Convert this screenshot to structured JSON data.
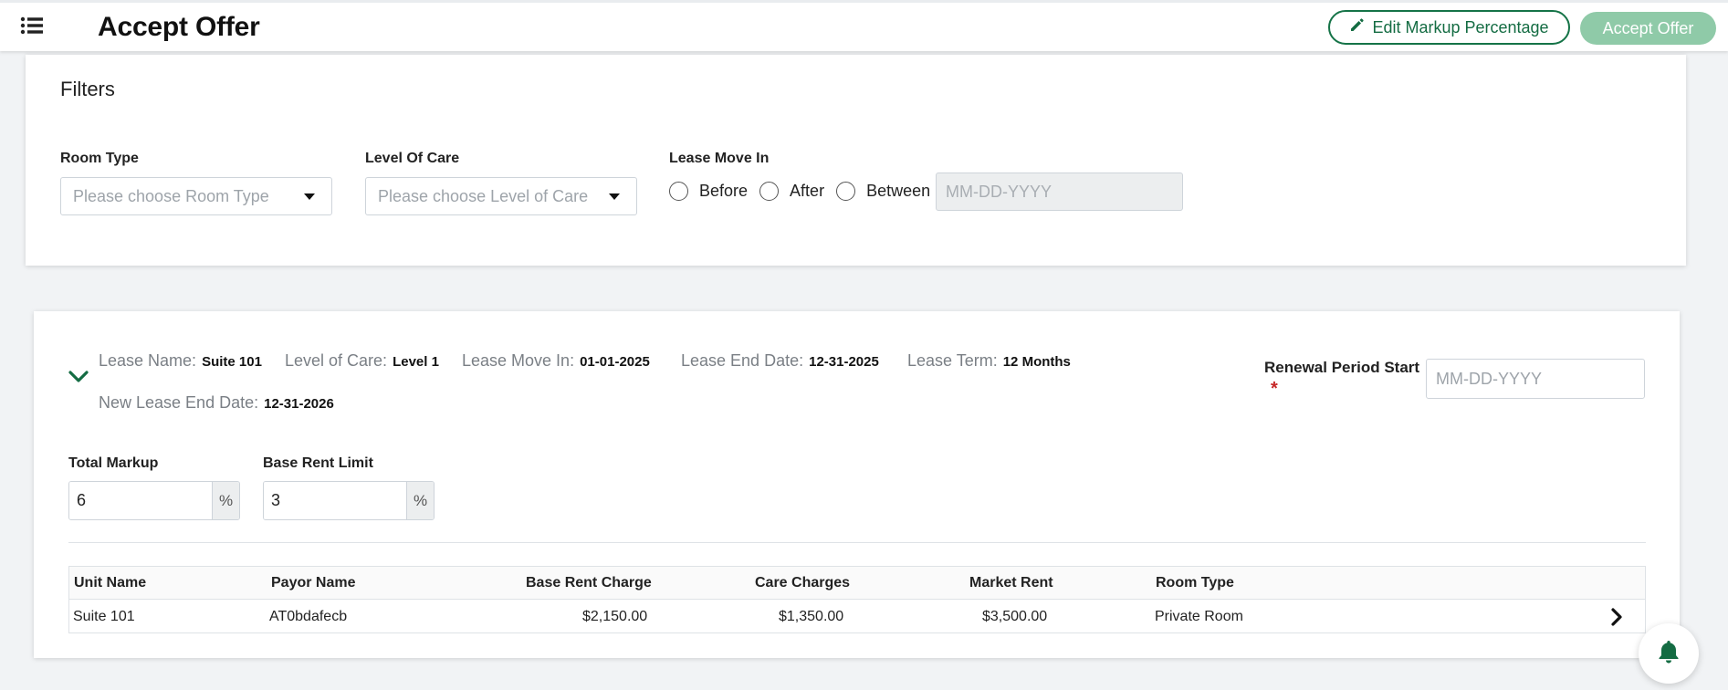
{
  "header": {
    "title": "Accept Offer",
    "edit_markup_label": "Edit Markup Percentage",
    "accept_offer_label": "Accept Offer"
  },
  "filters": {
    "title": "Filters",
    "room_type": {
      "label": "Room Type",
      "placeholder": "Please choose Room Type"
    },
    "level_of_care": {
      "label": "Level Of Care",
      "placeholder": "Please choose Level of Care"
    },
    "lease_move_in": {
      "label": "Lease Move In",
      "options": [
        "Before",
        "After",
        "Between"
      ],
      "date_placeholder": "MM-DD-YYYY"
    }
  },
  "lease": {
    "fields": [
      {
        "key": "Lease Name:",
        "value": "Suite 101"
      },
      {
        "key": "Level of Care:",
        "value": "Level 1"
      },
      {
        "key": "Lease Move In:",
        "value": "01-01-2025"
      },
      {
        "key": "Lease End Date:",
        "value": "12-31-2025"
      },
      {
        "key": "Lease Term:",
        "value": "12 Months"
      },
      {
        "key": "New Lease End Date:",
        "value": "12-31-2026"
      }
    ],
    "renewal": {
      "label": "Renewal Period Start",
      "required_mark": "*",
      "placeholder": "MM-DD-YYYY"
    },
    "total_markup": {
      "label": "Total Markup",
      "value": "6",
      "unit": "%"
    },
    "base_rent_limit": {
      "label": "Base Rent Limit",
      "value": "3",
      "unit": "%"
    },
    "table": {
      "headers": [
        "Unit Name",
        "Payor Name",
        "Base Rent Charge",
        "Care Charges",
        "Market Rent",
        "Room Type"
      ],
      "rows": [
        [
          "Suite 101",
          "AT0bdafecb",
          "$2,150.00",
          "$1,350.00",
          "$3,500.00",
          "Private Room"
        ]
      ]
    }
  },
  "icons": {
    "menu": "list-icon",
    "edit": "pencil-icon",
    "toggle": "chevron-down-icon",
    "row": "chevron-right-icon",
    "notifications": "bell-icon"
  },
  "colors": {
    "primary_green": "#146c43",
    "accept_disabled": "#8fcaa8",
    "required": "#c62828",
    "background": "#f1f3f5"
  }
}
